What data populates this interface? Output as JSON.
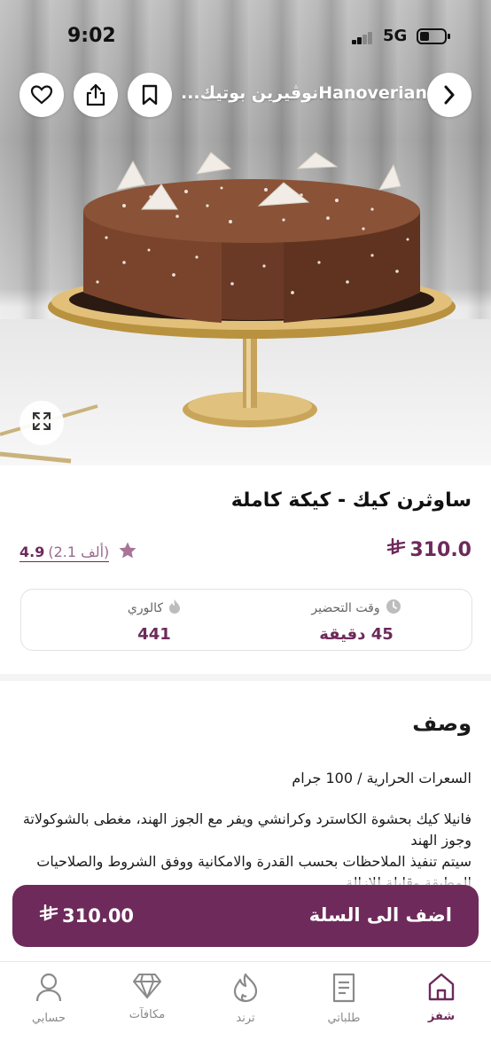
{
  "status_bar": {
    "time": "9:02",
    "network": "5G"
  },
  "header": {
    "shop_name": "...نوڤيرين بوتيكHanoverian",
    "back_icon": "chevron-right-icon",
    "bookmark_icon": "bookmark-icon",
    "share_icon": "share-icon",
    "favorite_icon": "heart-icon"
  },
  "product": {
    "title": "ساوثرن كيك - كيكة كاملة",
    "price": "310.0",
    "currency_icon": "saudi-riyal-icon",
    "rating": {
      "value": "4.9",
      "count": "(2.1 ألف)"
    },
    "stats": {
      "prep_label": "وقت التحضير",
      "prep_value": "45 دقيقة",
      "calorie_label": "كالوري",
      "calorie_value": "441"
    }
  },
  "description": {
    "heading": "وصف",
    "line1": "السعرات الحرارية / 100 جرام",
    "line2": "فانيلا كيك بحشوة الكاسترد وكرانشي ويفر مع الجوز الهند، مغطى بالشوكولاتة وجوز الهند",
    "line3": "سيتم تنفيذ الملاحظات بحسب القدرة والامكانية ووفق الشروط والصلاحيات المطبقة وقابلة للإزالة"
  },
  "cart": {
    "label": "اضف الى السلة",
    "price": "310.00"
  },
  "nav": {
    "items": [
      {
        "label": "شفز",
        "icon": "home-icon"
      },
      {
        "label": "طلباتي",
        "icon": "receipt-icon"
      },
      {
        "label": "ترند",
        "icon": "flame-icon"
      },
      {
        "label": "مكافآت",
        "icon": "diamond-icon"
      },
      {
        "label": "حسابي",
        "icon": "user-icon"
      }
    ]
  },
  "colors": {
    "brand": "#6d2a5a",
    "star": "#a8749a"
  }
}
